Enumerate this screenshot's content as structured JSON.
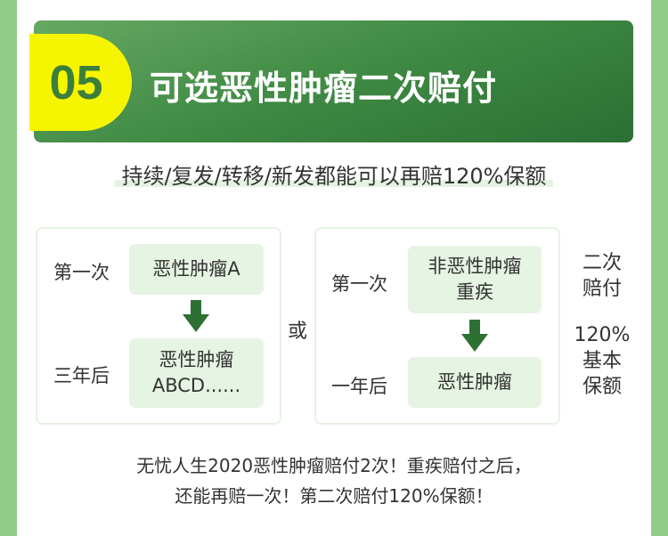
{
  "header": {
    "number": "05",
    "title": "可选恶性肿瘤二次赔付"
  },
  "subtitle": "持续/复发/转移/新发都能可以再赔120%保额",
  "left": {
    "first_label": "第一次",
    "first_value": "恶性肿瘤A",
    "second_label": "三年后",
    "second_value_line1": "恶性肿瘤",
    "second_value_line2": "ABCD......"
  },
  "or": "或",
  "right": {
    "first_label": "第一次",
    "first_value_line1": "非恶性肿瘤",
    "first_value_line2": "重疾",
    "second_label": "一年后",
    "second_value": "恶性肿瘤"
  },
  "side": {
    "line1": "二次",
    "line2": "赔付",
    "line3": "120%",
    "line4": "基本",
    "line5": "保额"
  },
  "footer": {
    "line1": "无忧人生2020恶性肿瘤赔付2次！重疾赔付之后，",
    "line2": "还能再赔一次！第二次赔付120%保额！"
  },
  "colors": {
    "accent": "#2d7033",
    "tab": "#f6f500",
    "pill": "#e6f4e3"
  }
}
